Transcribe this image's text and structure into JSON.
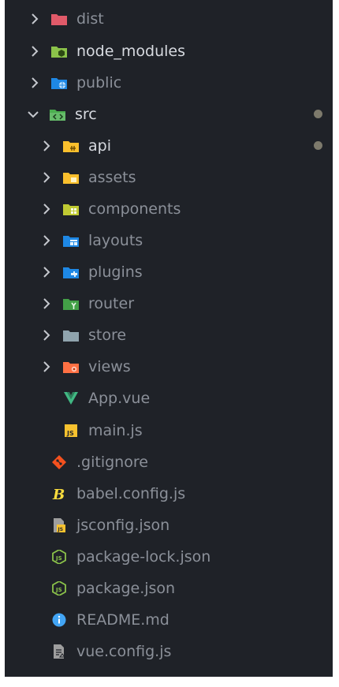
{
  "explorer": {
    "items": [
      {
        "label": "dist",
        "icon": "folder-dist-icon",
        "kind": "folder",
        "expanded": false,
        "dimmed": true
      },
      {
        "label": "node_modules",
        "icon": "folder-node-icon",
        "kind": "folder",
        "expanded": false,
        "dimmed": false
      },
      {
        "label": "public",
        "icon": "folder-public-icon",
        "kind": "folder",
        "expanded": false,
        "dimmed": true
      },
      {
        "label": "src",
        "icon": "folder-src-icon",
        "kind": "folder",
        "expanded": true,
        "dimmed": false,
        "modified": true
      },
      {
        "label": "api",
        "icon": "folder-api-icon",
        "kind": "folder",
        "expanded": false,
        "dimmed": false,
        "modified": true
      },
      {
        "label": "assets",
        "icon": "folder-assets-icon",
        "kind": "folder",
        "expanded": false,
        "dimmed": true
      },
      {
        "label": "components",
        "icon": "folder-components-icon",
        "kind": "folder",
        "expanded": false,
        "dimmed": true
      },
      {
        "label": "layouts",
        "icon": "folder-layouts-icon",
        "kind": "folder",
        "expanded": false,
        "dimmed": true
      },
      {
        "label": "plugins",
        "icon": "folder-plugins-icon",
        "kind": "folder",
        "expanded": false,
        "dimmed": true
      },
      {
        "label": "router",
        "icon": "folder-router-icon",
        "kind": "folder",
        "expanded": false,
        "dimmed": true
      },
      {
        "label": "store",
        "icon": "folder-store-icon",
        "kind": "folder",
        "expanded": false,
        "dimmed": true
      },
      {
        "label": "views",
        "icon": "folder-views-icon",
        "kind": "folder",
        "expanded": false,
        "dimmed": true
      },
      {
        "label": "App.vue",
        "icon": "vue-file-icon",
        "kind": "file",
        "dimmed": true
      },
      {
        "label": "main.js",
        "icon": "js-file-icon",
        "kind": "file",
        "dimmed": true
      },
      {
        "label": ".gitignore",
        "icon": "git-file-icon",
        "kind": "file",
        "dimmed": true
      },
      {
        "label": "babel.config.js",
        "icon": "babel-file-icon",
        "kind": "file",
        "dimmed": true
      },
      {
        "label": "jsconfig.json",
        "icon": "jsconfig-file-icon",
        "kind": "file",
        "dimmed": true
      },
      {
        "label": "package-lock.json",
        "icon": "nodejs-file-icon",
        "kind": "file",
        "dimmed": true
      },
      {
        "label": "package.json",
        "icon": "nodejs-file-icon",
        "kind": "file",
        "dimmed": true
      },
      {
        "label": "README.md",
        "icon": "info-file-icon",
        "kind": "file",
        "dimmed": true
      },
      {
        "label": "vue.config.js",
        "icon": "config-file-icon",
        "kind": "file",
        "dimmed": true
      }
    ]
  },
  "colors": {
    "background": "#1f2228",
    "text_dim": "#8b9099",
    "text_bright": "#d7dae0",
    "modified_dot": "#7d7a6c"
  }
}
